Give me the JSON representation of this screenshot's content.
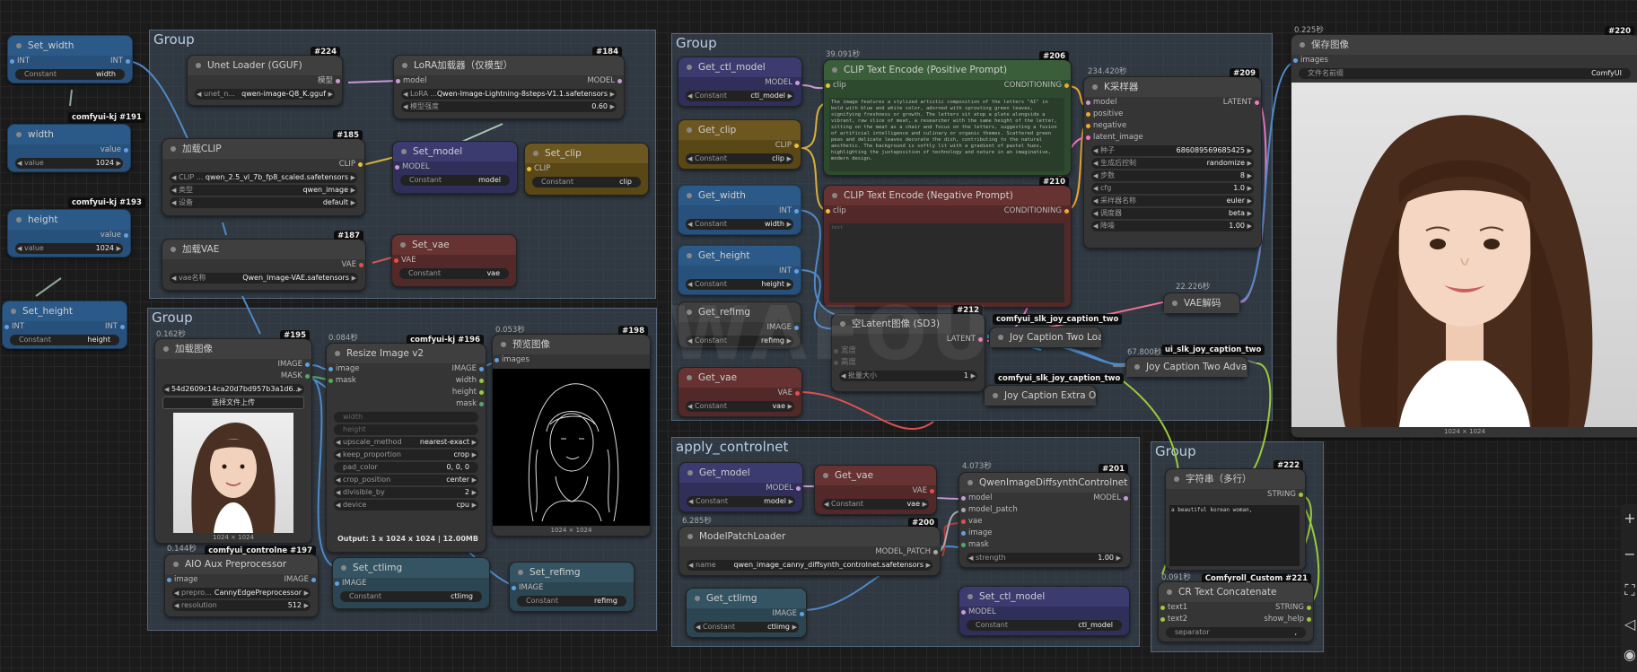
{
  "groups": {
    "g1": "Group",
    "g2": "Group",
    "g3": "Group",
    "g4": "apply_controlnet",
    "g5": "Group"
  },
  "set_width": {
    "title": "Set_width",
    "in": "INT",
    "out": "INT",
    "w_label": "Constant",
    "w_value": "width"
  },
  "badge_191": "comfyui-kj  #191",
  "width_node": {
    "title": "width",
    "out": "value",
    "w_label": "value",
    "w_value": "1024"
  },
  "badge_193": "comfyui-kj  #193",
  "height_node": {
    "title": "height",
    "out": "value",
    "w_label": "value",
    "w_value": "1024"
  },
  "set_height": {
    "title": "Set_height",
    "in": "INT",
    "out": "INT",
    "w_label": "Constant",
    "w_value": "height"
  },
  "unet": {
    "title": "Unet Loader (GGUF)",
    "badge": "#224",
    "out": "模型",
    "w_label": "unet_n...",
    "w_value": "qwen-image-Q8_K.gguf"
  },
  "lora": {
    "title": "LoRA加载器（仅模型）",
    "badge": "#184",
    "in": "model",
    "out": "MODEL",
    "w1_label": "LoRA ...",
    "w1_value": "Qwen-Image-Lightning-8steps-V1.1.safetensors",
    "w2_label": "模型强度",
    "w2_value": "0.60"
  },
  "clip_loader": {
    "title": "加载CLIP",
    "badge": "#185",
    "out": "CLIP",
    "w1_label": "CLIP ...",
    "w1_value": "qwen_2.5_vl_7b_fp8_scaled.safetensors",
    "w2_label": "类型",
    "w2_value": "qwen_image",
    "w3_label": "设备",
    "w3_value": "default"
  },
  "set_model": {
    "title": "Set_model",
    "in": "MODEL",
    "w_label": "Constant",
    "w_value": "model"
  },
  "set_clip": {
    "title": "Set_clip",
    "in": "CLIP",
    "w_label": "Constant",
    "w_value": "clip"
  },
  "vae_loader": {
    "title": "加载VAE",
    "badge": "#187",
    "out": "VAE",
    "w_label": "vae名称",
    "w_value": "Qwen_Image-VAE.safetensors"
  },
  "set_vae": {
    "title": "Set_vae",
    "in": "VAE",
    "w_label": "Constant",
    "w_value": "vae"
  },
  "load_image": {
    "timing": "0.162秒",
    "title": "加载图像",
    "badge": "#195",
    "out1": "IMAGE",
    "out2": "MASK",
    "w_value": "54d2609c14ca20d7bd957b3a1d6...",
    "upload": "选择文件上传",
    "caption": "1024 × 1024"
  },
  "resize": {
    "timing": "0.084秒",
    "title": "Resize Image v2",
    "badge": "comfyui-kj  #196",
    "in1": "image",
    "in2": "mask",
    "out1": "IMAGE",
    "out2": "width",
    "out3": "height",
    "out4": "mask",
    "w_width": "width",
    "w_height": "height",
    "w1_label": "upscale_method",
    "w1_value": "nearest-exact",
    "w2_label": "keep_proportion",
    "w2_value": "crop",
    "w3_label": "pad_color",
    "w3_value": "0, 0, 0",
    "w4_label": "crop_position",
    "w4_value": "center",
    "w5_label": "divisible_by",
    "w5_value": "2",
    "w6_label": "device",
    "w6_value": "cpu",
    "output": "Output: 1 x 1024 x 1024 | 12.00MB"
  },
  "preview": {
    "timing": "0.053秒",
    "title": "预览图像",
    "badge": "#198",
    "in": "images",
    "caption": "1024 × 1024"
  },
  "aux": {
    "timing": "0.144秒",
    "title": "AIO Aux Preprocessor",
    "badge": "comfyui_controlne #197",
    "in": "image",
    "out": "IMAGE",
    "w1_label": "prepro...",
    "w1_value": "CannyEdgePreprocessor",
    "w2_label": "resolution",
    "w2_value": "512"
  },
  "set_ctlimg": {
    "title": "Set_ctlimg",
    "in": "IMAGE",
    "w_label": "Constant",
    "w_value": "ctlimg"
  },
  "set_refimg": {
    "title": "Set_refimg",
    "in": "IMAGE",
    "w_label": "Constant",
    "w_value": "refimg"
  },
  "get_ctl_model": {
    "title": "Get_ctl_model",
    "out": "MODEL",
    "w_label": "Constant",
    "w_value": "ctl_model"
  },
  "get_clip": {
    "title": "Get_clip",
    "out": "CLIP",
    "w_label": "Constant",
    "w_value": "clip"
  },
  "get_width": {
    "title": "Get_width",
    "out": "INT",
    "w_label": "Constant",
    "w_value": "width"
  },
  "get_height": {
    "title": "Get_height",
    "out": "INT",
    "w_label": "Constant",
    "w_value": "height"
  },
  "get_refimg": {
    "title": "Get_refimg",
    "out": "IMAGE",
    "w_label": "Constant",
    "w_value": "refimg"
  },
  "get_vae": {
    "title": "Get_vae",
    "out": "VAE",
    "w_label": "Constant",
    "w_value": "vae"
  },
  "clip_pos": {
    "timing": "39.091秒",
    "title": "CLIP Text Encode (Positive Prompt)",
    "badge": "#206",
    "in": "clip",
    "out": "CONDITIONING",
    "text": "The image features a stylized artistic composition of the letters \"AI\" in bold with blue and white color, adorned with sprouting green leaves, signifying freshness or growth. The letters sit atop a plate alongside a vibrant, raw slice of meat, a researcher with the same height of the letter, sitting on the meat as a chair and focus on the letters, suggesting a fusion of artificial intelligence and culinary or organic themes. Scattered green peas and delicate leaves decorate the dish, contributing to the natural aesthetic. The background is softly lit with a gradient of pastel hues, highlighting the juxtaposition of technology and nature in an imaginative, modern design."
  },
  "clip_neg": {
    "title": "CLIP Text Encode (Negative Prompt)",
    "badge": "#210",
    "in": "clip",
    "out": "CONDITIONING",
    "text": "text"
  },
  "latent": {
    "title": "空Latent图像 (SD3)",
    "badge": "#212",
    "out": "LATENT",
    "in1": "宽度",
    "in2": "高度",
    "w_label": "批量大小",
    "w_value": "1"
  },
  "ksampler": {
    "timing": "234.420秒",
    "title": "K采样器",
    "badge": "#209",
    "in1": "model",
    "in2": "positive",
    "in3": "negative",
    "in4": "latent_image",
    "out": "LATENT",
    "w1_label": "种子",
    "w1_value": "686089569685425",
    "w2_label": "生成后控制",
    "w2_value": "randomize",
    "w3_label": "步数",
    "w3_value": "8",
    "w4_label": "cfg",
    "w4_value": "1.0",
    "w5_label": "采样器名称",
    "w5_value": "euler",
    "w6_label": "调度器",
    "w6_value": "beta",
    "w7_label": "降噪",
    "w7_value": "1.00"
  },
  "vae_decode": {
    "timing": "22.226秒",
    "title": "VAE解码"
  },
  "joy_load": {
    "badge": "comfyui_slk_joy_caption_two",
    "title": "Joy Caption Two Load"
  },
  "joy_adv": {
    "timing": "67.800秒",
    "badge": "ui_slk_joy_caption_two",
    "title": "Joy Caption Two Adva"
  },
  "joy_extra": {
    "badge": "comfyui_slk_joy_caption_two",
    "title": "Joy Caption Extra Op"
  },
  "save": {
    "timing": "0.225秒",
    "title": "保存图像",
    "badge": "#220",
    "in": "images",
    "w_label": "文件名前缀",
    "w_value": "ComfyUI",
    "caption": "1024 × 1024"
  },
  "ctl_get_model": {
    "title": "Get_model",
    "out": "MODEL",
    "w_label": "Constant",
    "w_value": "model"
  },
  "ctl_get_vae": {
    "title": "Get_vae",
    "out": "VAE",
    "w_label": "Constant",
    "w_value": "vae"
  },
  "diffsynth": {
    "timing": "4.073秒",
    "title": "QwenImageDiffsynthControlnet",
    "badge": "#201",
    "in1": "model",
    "in2": "model_patch",
    "in3": "vae",
    "in4": "image",
    "in5": "mask",
    "out": "MODEL",
    "w_label": "strength",
    "w_value": "1.00"
  },
  "patch_loader": {
    "timing": "6.285秒",
    "title": "ModelPatchLoader",
    "badge": "#200",
    "out": "MODEL_PATCH",
    "w_label": "name",
    "w_value": "qwen_image_canny_diffsynth_controlnet.safetensors"
  },
  "get_ctlimg": {
    "title": "Get_ctlimg",
    "out": "IMAGE",
    "w_label": "Constant",
    "w_value": "ctlimg"
  },
  "set_ctl_model": {
    "title": "Set_ctl_model",
    "in": "MODEL",
    "w_label": "Constant",
    "w_value": "ctl_model"
  },
  "string_ml": {
    "title": "字符串（多行）",
    "badge": "#222",
    "out": "STRING",
    "text": "a beautiful korean woman,"
  },
  "concat": {
    "timing": "0.091秒",
    "badge": "Comfyroll_Custom  #221",
    "title": "CR Text Concatenate",
    "in1": "text1",
    "in2": "text2",
    "out1": "STRING",
    "out2": "show_help",
    "w_label": "separator",
    "w_value": ","
  },
  "watermark": "WAFOU"
}
